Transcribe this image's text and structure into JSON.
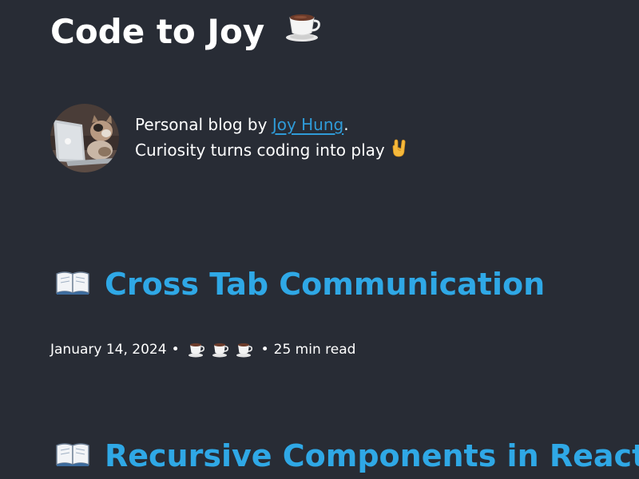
{
  "site": {
    "title": "Code to Joy",
    "title_icon": "coffee-cup-icon"
  },
  "bio": {
    "prefix": "Personal blog by ",
    "author": "Joy Hung",
    "suffix": ".",
    "tagline": "Curiosity turns coding into play",
    "tagline_icon": "rock-on-hand-icon",
    "avatar_icon": "cat-with-laptop-avatar"
  },
  "posts": [
    {
      "icon": "open-book-icon",
      "title": "Cross Tab Communication",
      "date": "January 14, 2024",
      "separator": "•",
      "reading_cups": 3,
      "reading_time": "25 min read"
    },
    {
      "icon": "open-book-icon",
      "title": "Recursive Components in React"
    }
  ],
  "colors": {
    "background": "#282c35",
    "link": "#2fa8e6",
    "text": "#ffffff"
  }
}
